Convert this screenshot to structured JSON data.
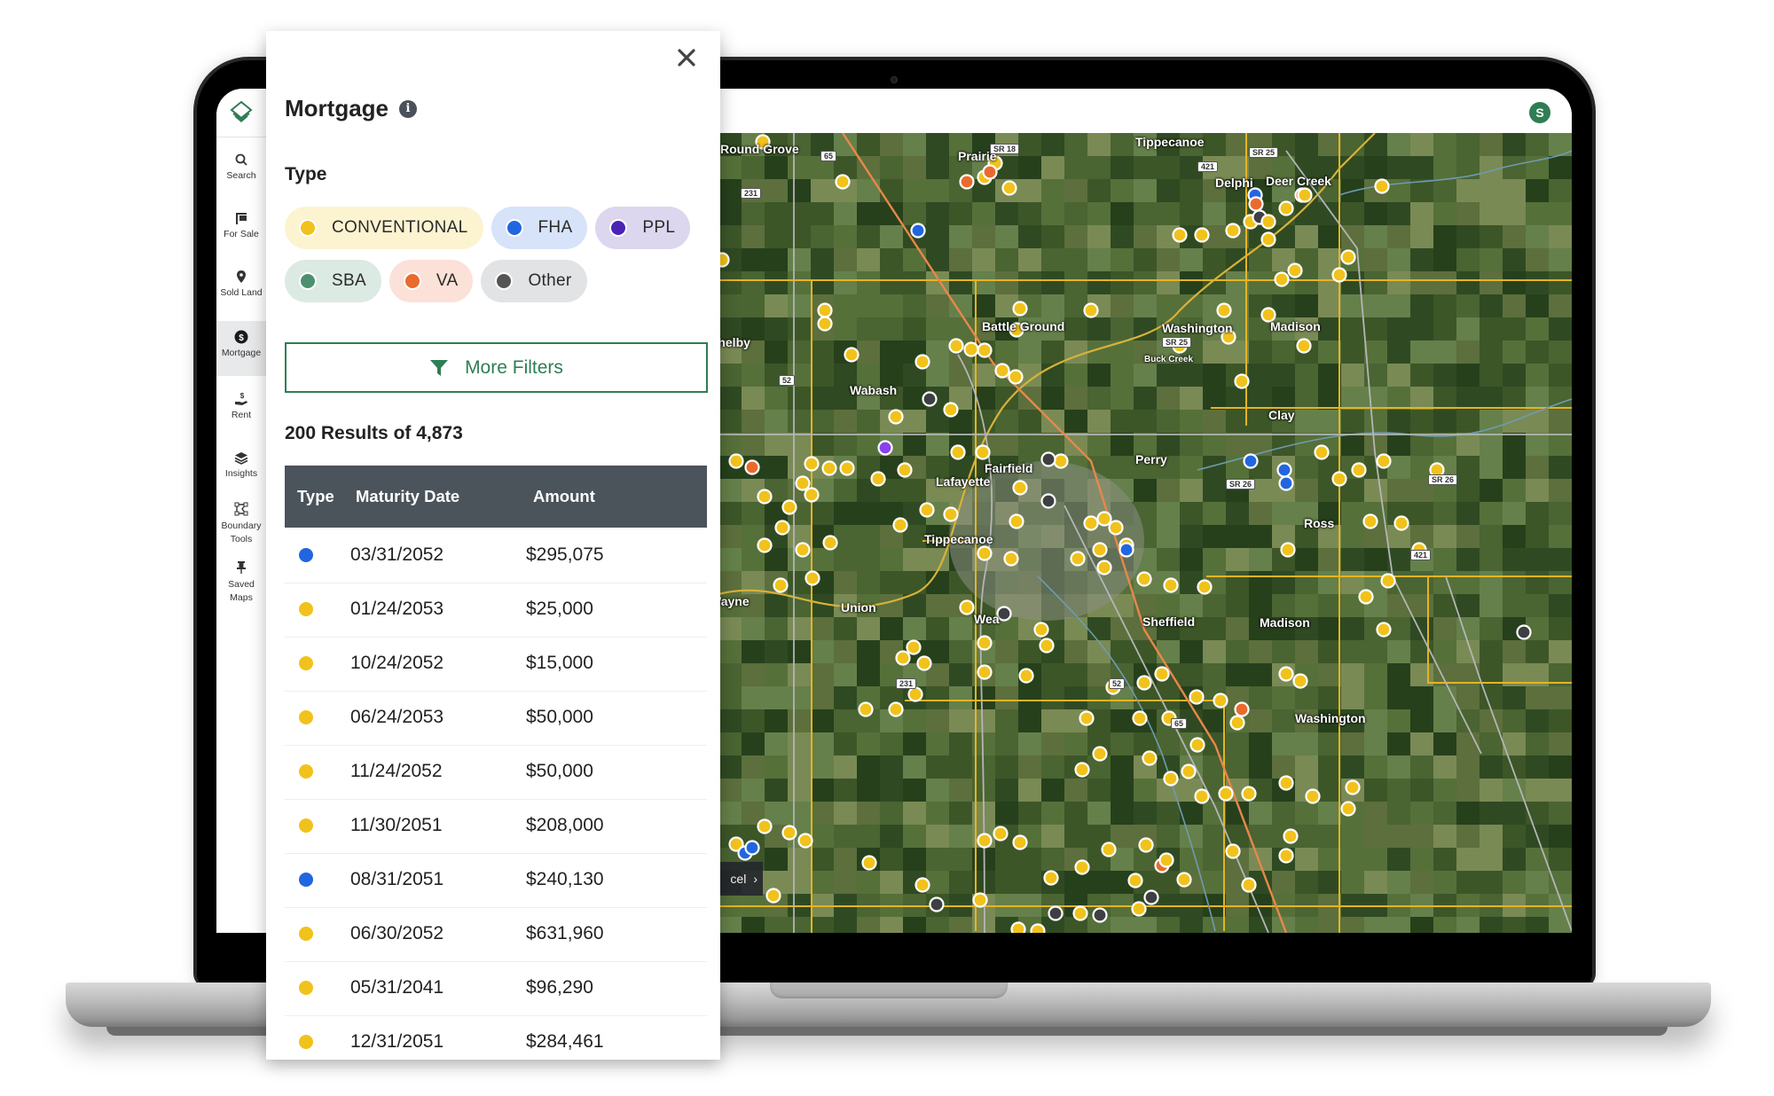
{
  "app": {
    "avatar_initial": "S",
    "accent_color": "#2f7d55"
  },
  "sidebar": {
    "items": [
      {
        "label": "Search",
        "icon": "search-icon"
      },
      {
        "label": "For Sale",
        "icon": "for-sale-sign-icon"
      },
      {
        "label": "Sold Land",
        "icon": "map-pin-icon"
      },
      {
        "label": "Mortgage",
        "icon": "dollar-circle-icon",
        "active": true
      },
      {
        "label": "Rent",
        "icon": "hand-dollar-icon"
      },
      {
        "label": "Insights",
        "icon": "layers-icon"
      },
      {
        "label": "Boundary Tools",
        "icon": "polygon-draw-icon"
      },
      {
        "label": "Saved Maps",
        "icon": "pushpin-icon"
      }
    ]
  },
  "panel": {
    "title": "Mortgage",
    "type_heading": "Type",
    "type_chips": [
      {
        "label": "CONVENTIONAL",
        "color": "#f1c21b",
        "bg": "#fcf3d0"
      },
      {
        "label": "FHA",
        "color": "#2166e0",
        "bg": "#d7e3f8"
      },
      {
        "label": "PPL",
        "color": "#4a22b5",
        "bg": "#ddd6ef"
      },
      {
        "label": "SBA",
        "color": "#4c9070",
        "bg": "#dbeae2"
      },
      {
        "label": "VA",
        "color": "#ea6a2e",
        "bg": "#fbe1d8"
      },
      {
        "label": "Other",
        "color": "#555555",
        "bg": "#e1e3e5"
      }
    ],
    "more_filters_label": "More Filters",
    "results_text": "200 Results of 4,873",
    "table": {
      "columns": [
        "Type",
        "Maturity Date",
        "Amount"
      ],
      "rows": [
        {
          "type": "FHA",
          "color": "#2166e0",
          "date": "03/31/2052",
          "amount": "$295,075"
        },
        {
          "type": "CONVENTIONAL",
          "color": "#f1c21b",
          "date": "01/24/2053",
          "amount": "$25,000"
        },
        {
          "type": "CONVENTIONAL",
          "color": "#f1c21b",
          "date": "10/24/2052",
          "amount": "$15,000"
        },
        {
          "type": "CONVENTIONAL",
          "color": "#f1c21b",
          "date": "06/24/2053",
          "amount": "$50,000"
        },
        {
          "type": "CONVENTIONAL",
          "color": "#f1c21b",
          "date": "11/24/2052",
          "amount": "$50,000"
        },
        {
          "type": "CONVENTIONAL",
          "color": "#f1c21b",
          "date": "11/30/2051",
          "amount": "$208,000"
        },
        {
          "type": "FHA",
          "color": "#2166e0",
          "date": "08/31/2051",
          "amount": "$240,130"
        },
        {
          "type": "CONVENTIONAL",
          "color": "#f1c21b",
          "date": "06/30/2052",
          "amount": "$631,960"
        },
        {
          "type": "CONVENTIONAL",
          "color": "#f1c21b",
          "date": "05/31/2041",
          "amount": "$96,290"
        },
        {
          "type": "CONVENTIONAL",
          "color": "#f1c21b",
          "date": "12/31/2051",
          "amount": "$284,461"
        }
      ]
    }
  },
  "map": {
    "parcel_button_label": "cel",
    "place_labels": [
      "Round Grove",
      "Prairie",
      "Tippecanoe",
      "Delphi",
      "Deer Creek",
      "Battle Ground",
      "Washington",
      "Buck Creek",
      "Madison",
      "Wabash",
      "Clay",
      "Fairfield",
      "Lafayette",
      "Perry",
      "Ross",
      "Tippecanoe",
      "Union",
      "Wea",
      "Sheffield",
      "Madison",
      "Washington",
      "Shelby",
      "Wayne"
    ],
    "road_shields": [
      "65",
      "231",
      "SR 18",
      "SR 25",
      "421",
      "52",
      "SR 26",
      "SR 25",
      "SR 26",
      "421",
      "231",
      "52",
      "65"
    ],
    "marker_colors": {
      "conventional": "#f1c21b",
      "fha": "#2166e0",
      "ppl": "#8a3ff0",
      "va": "#ea6a2e",
      "other": "#3d3f43"
    }
  }
}
